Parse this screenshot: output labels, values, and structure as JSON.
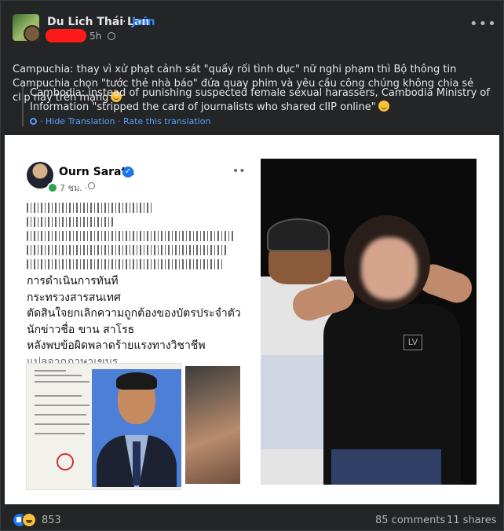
{
  "header": {
    "page_name": "Du Lich Thái Lan",
    "separator": "·",
    "join_label": "Join",
    "time": "5h",
    "more": "•••"
  },
  "post": {
    "text": "Campuchia: thay vì xử phạt cảnh sát \"quấy rối tình dục\" nữ nghi phạm thì Bộ thông tin Campuchia chọn \"tước thẻ nhà báo\" đứa quay phim và yêu cầu công chúng không chia sẻ clip này trên mạng",
    "translation": "Cambodia: instead of punishing suspected female sexual harassers, Cambodia Ministry of Information \"stripped the card of journalists who shared cIIP online\"",
    "hide_translation": "· Hide Translation",
    "rate_translation": "· Rate this translation"
  },
  "embedded": {
    "name": "Ourn Sarath",
    "time": "7 ชม. ·",
    "more": "••",
    "thai_lines": [
      "การดำเนินการทันที",
      "กระทรวงสารสนเทศ",
      "ตัดสินใจยกเลิกความถูกต้องของบัตรประจำตัว",
      "นักข่าวชื่อ ขาน สาโรธ",
      "หลังพบข้อผิดพลาดร้ายแรงทางวิชาชีพ"
    ],
    "translated_from": "แปลจากภาษาเขมร",
    "shirt_logo": "LV"
  },
  "footer": {
    "reaction_count": "853",
    "comments": "85 comments",
    "shares": "11 shares"
  },
  "colors": {
    "background": "#242526",
    "link": "#2d88ff",
    "redaction": "#ff1a1a"
  }
}
